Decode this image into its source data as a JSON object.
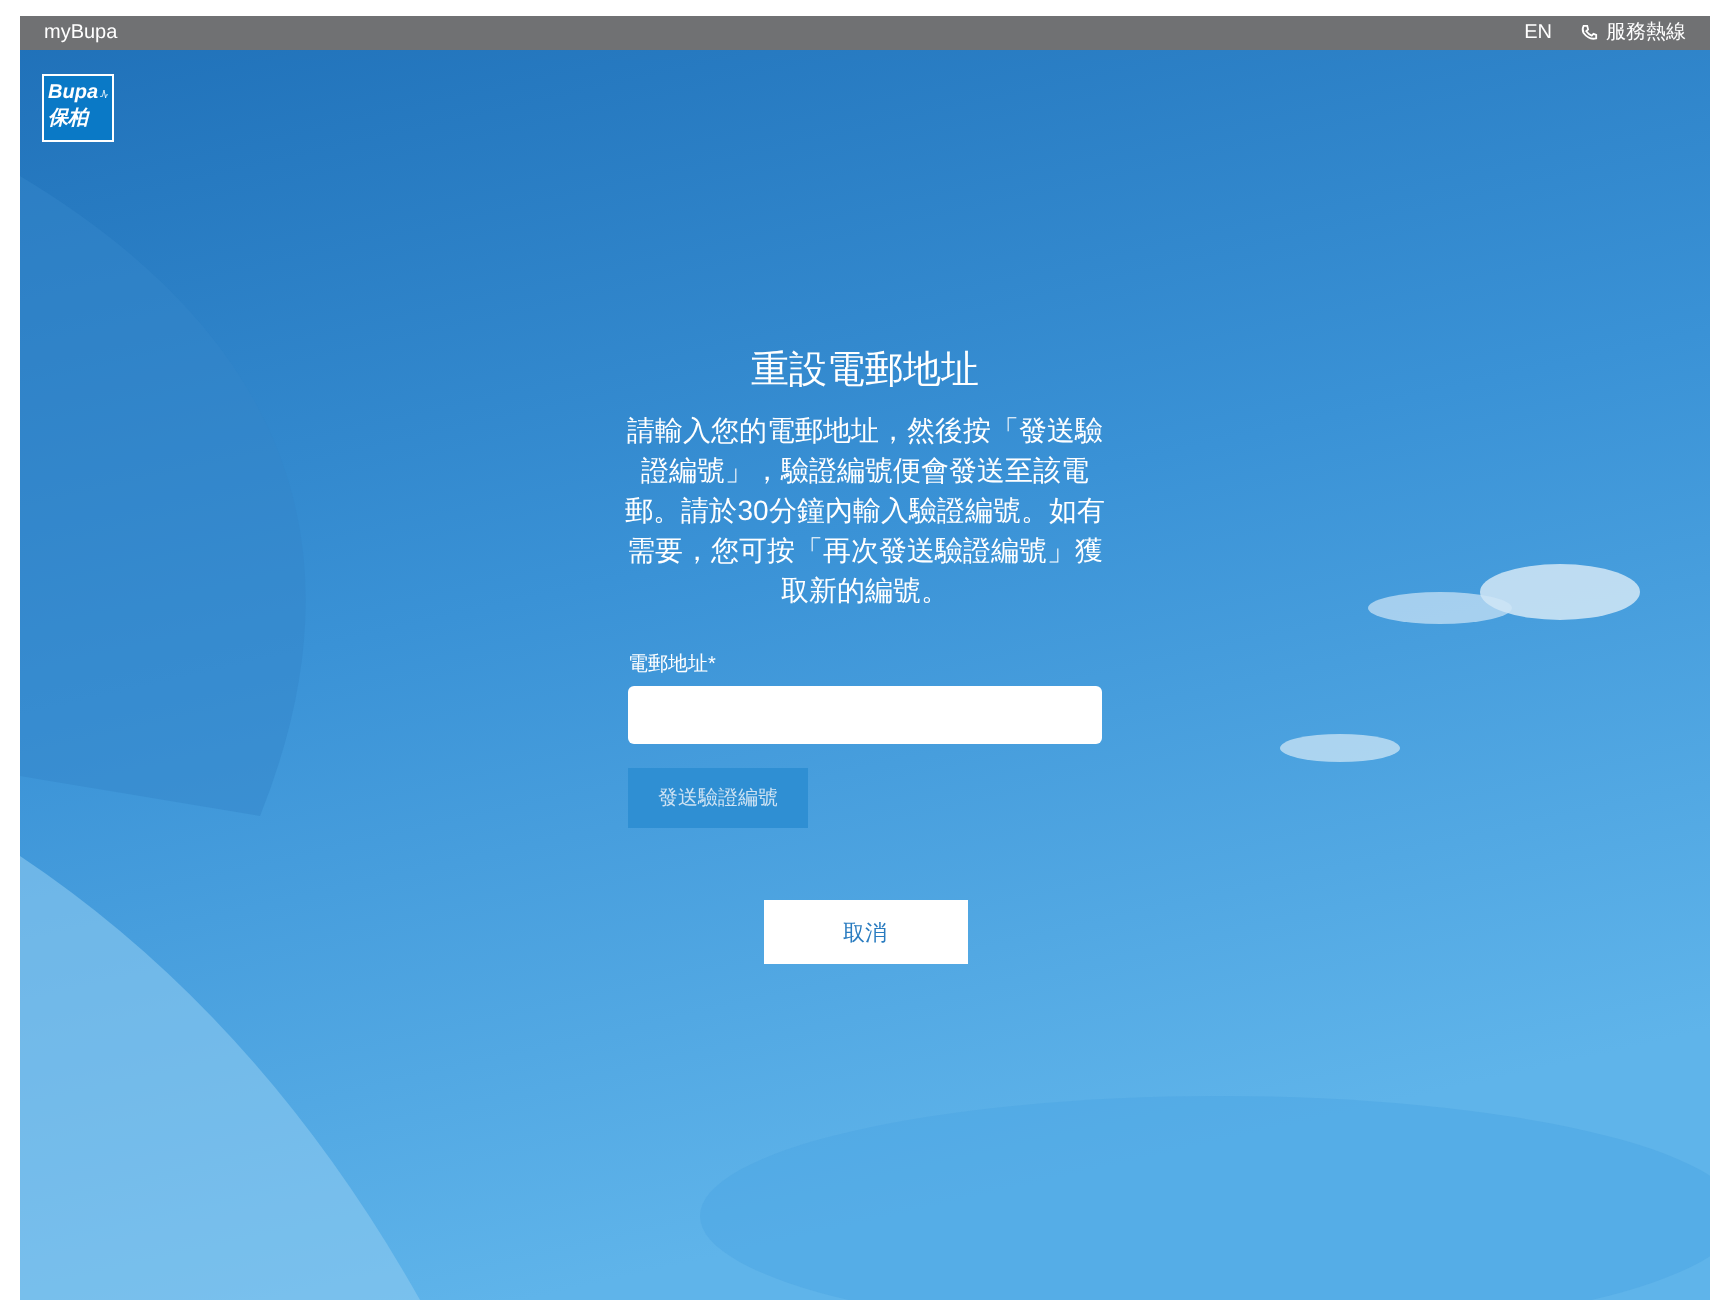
{
  "top_bar": {
    "brand": "myBupa",
    "language": "EN",
    "hotline": "服務熱線"
  },
  "logo": {
    "line_1": "Bupa",
    "line_2": "保柏"
  },
  "title": "重設電郵地址",
  "description": "請輸入您的電郵地址，然後按「發送驗證編號」，驗證編號便會發送至該電郵。請於30分鐘內輸入驗證編號。如有需要，您可按「再次發送驗證編號」獲取新的編號。",
  "email_field": {
    "label": "電郵地址*"
  },
  "send_button": {
    "label": "發送驗證編號",
    "disabled": true
  },
  "cancel_button": {
    "label": "取消"
  }
}
